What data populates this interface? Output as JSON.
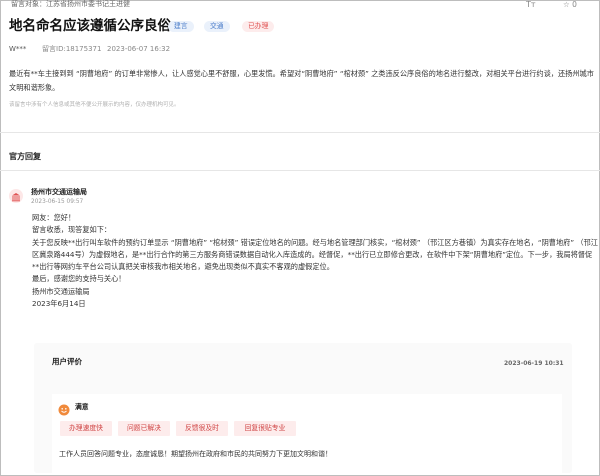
{
  "header": {
    "target": "留言对象：江苏省扬州市委书记王进健",
    "font_size_label": "Tт",
    "favorite_count": "0"
  },
  "message": {
    "title": "地名命名应该遵循公序良俗",
    "tags": [
      "建言",
      "交通",
      "已办理"
    ],
    "author": "W***",
    "message_id": "留言ID:18175371",
    "time": "2023-06-07 16:32",
    "content": "最近有**车主接到到 “阴曹地府” 的订单非常惨人，让人感觉心里不舒服，心里发慌。希望对“阴曹地府” “棺材颈” 之类违反公序良俗的地名进行整改，对相关平台进行约谈，还扬州城市文明和谐形象。",
    "disclaimer": "该留言中涉有个人信息或其他不便公开展示的内容，仅办理机构可见。"
  },
  "official_reply": {
    "section_title": "官方回复",
    "org_name": "扬州市交通运输局",
    "time": "2023-06-15 09:57",
    "lines": [
      "网友：您好！",
      "留言收悉，现答复如下：",
      "关于您反映**出行叫车软件的预约订单显示 “阴曹地府” “棺材颈” 错误定位地名的问题。经与地名管理部门核实，“棺材颈” （邗江区方巷镇）为真实存在地名，“阴曹地府” （邗江区冀泉路444号）为虚假地名，是**出行合作的第三方服务商错误数据自动化入库造成的。经督促，**出行已立即修合更改，在软件中下架“阴曹地府”定位。下一步，我局将督促**出行等网约车平台公司认真把关审核我市相关地名，避免出现类似不真实不客观的虚假定位。",
      "最后，感谢您的支持与关心！",
      "扬州市交通运输局",
      "2023年6月14日"
    ]
  },
  "user_evaluation": {
    "section_title": "用户评价",
    "time": "2023-06-19 10:31",
    "rating": "满意",
    "tags": [
      "办理速度快",
      "问题已解决",
      "反馈很及时",
      "回复很贴专业"
    ],
    "comment": "工作人员回答问题专业，态度诚恳！期望扬州在政府和市民的共同努力下更加文明和谐！"
  },
  "colors": {
    "accent_red": "#e05252",
    "accent_blue": "#4a7cc9",
    "smile_orange": "#f08a3c"
  }
}
